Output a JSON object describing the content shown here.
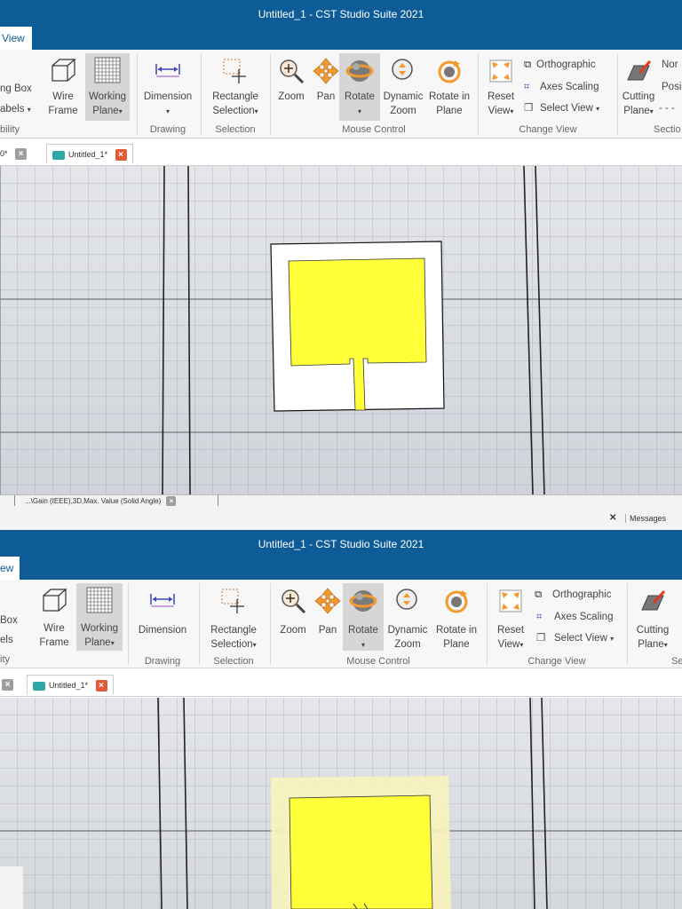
{
  "window": {
    "title": "Untitled_1 - CST Studio Suite 2021"
  },
  "ribbon_tab": {
    "label": "View"
  },
  "ribbon": {
    "visibility": {
      "bounding_box": "ng Box",
      "labels": "abels",
      "group": "bility"
    },
    "wire_frame": {
      "line1": "Wire",
      "line2": "Frame"
    },
    "working_plane": {
      "line1": "Working",
      "line2": "Plane"
    },
    "dimension": {
      "label": "Dimension",
      "group": "Drawing"
    },
    "rectangle_selection": {
      "line1": "Rectangle",
      "line2": "Selection",
      "group": "Selection"
    },
    "zoom": {
      "label": "Zoom"
    },
    "pan": {
      "label": "Pan"
    },
    "rotate": {
      "label": "Rotate"
    },
    "dynamic_zoom": {
      "line1": "Dynamic",
      "line2": "Zoom"
    },
    "rotate_in_plane": {
      "line1": "Rotate in",
      "line2": "Plane"
    },
    "mouse_control_group": "Mouse Control",
    "reset_view": {
      "line1": "Reset",
      "line2": "View"
    },
    "orthographic": "Orthographic",
    "axes_scaling": "Axes Scaling",
    "select_view": "Select View",
    "change_view_group": "Change View",
    "cutting_plane": {
      "line1": "Cutting",
      "line2": "Plane"
    },
    "normal_partial": "Nor",
    "position_partial": "Posi",
    "section_group_partial": "Sectio"
  },
  "doc_tabs": {
    "prev_partial": "0*",
    "active": "Untitled_1*"
  },
  "status": {
    "result_tab": "...\\Gain (IEEE),3D,Max. Value (Solid Angle)",
    "messages": "Messages"
  },
  "second_view": {
    "visibility": {
      "bounding_box": "Box",
      "labels": "els",
      "group": "ity"
    },
    "group_partial": "Se"
  },
  "colors": {
    "title_bar": "#0e5c97",
    "patch": "#ffff3a",
    "substrate": "#ffffff",
    "substrate_highlight": "#f8f3bb",
    "viewport_bg": "#dadde3"
  }
}
